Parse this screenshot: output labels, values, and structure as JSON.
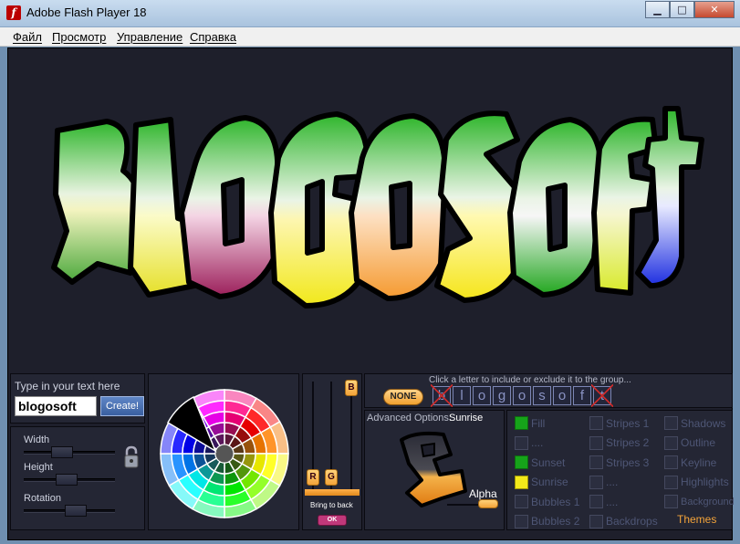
{
  "window": {
    "title": "Adobe Flash Player 18",
    "app_icon_glyph": "f",
    "controls": {
      "minimize": "▁",
      "maximize": "□",
      "close": "✕"
    }
  },
  "menu": [
    "Файл",
    "Просмотр",
    "Управление",
    "Справка"
  ],
  "graffiti": {
    "text": "BLOGOSOFT"
  },
  "text_panel": {
    "label": "Type in your text here",
    "input_value": "blogosoft",
    "create_label": "Create!"
  },
  "size_panel": {
    "width_label": "Width",
    "height_label": "Height",
    "rotation_label": "Rotation",
    "width_level": 0.3,
    "height_level": 0.35,
    "rotation_level": 0.45
  },
  "rgb_panel": {
    "r_label": "R",
    "g_label": "G",
    "b_label": "B",
    "bring_label": "Bring to back",
    "ok_label": "OK"
  },
  "letters_panel": {
    "hint": "Click a letter to include or exclude it to the group...",
    "none_label": "NONE",
    "letters": [
      {
        "char": "b",
        "excluded": true
      },
      {
        "char": "l",
        "excluded": false
      },
      {
        "char": "o",
        "excluded": false
      },
      {
        "char": "g",
        "excluded": false
      },
      {
        "char": "o",
        "excluded": false
      },
      {
        "char": "s",
        "excluded": false
      },
      {
        "char": "o",
        "excluded": false
      },
      {
        "char": "f",
        "excluded": false
      },
      {
        "char": "t",
        "excluded": true
      }
    ]
  },
  "advanced": {
    "label": "Advanced Options:",
    "value": "Sunrise",
    "alpha_label": "Alpha"
  },
  "options": {
    "col1": [
      {
        "label": "Fill",
        "state": "green"
      },
      {
        "label": "....",
        "state": "off"
      },
      {
        "label": "Sunset",
        "state": "green"
      },
      {
        "label": "Sunrise",
        "state": "yellow"
      },
      {
        "label": "Bubbles 1",
        "state": "off"
      },
      {
        "label": "Bubbles 2",
        "state": "off"
      }
    ],
    "col2": [
      {
        "label": "Stripes 1"
      },
      {
        "label": "Stripes 2"
      },
      {
        "label": "Stripes 3"
      },
      {
        "label": "...."
      },
      {
        "label": "...."
      },
      {
        "label": "Backdrops"
      }
    ],
    "col3": [
      {
        "label": "Shadows"
      },
      {
        "label": "Outline"
      },
      {
        "label": "Keyline"
      },
      {
        "label": "Highlights"
      },
      {
        "label": "Background"
      }
    ],
    "themes_label": "Themes"
  },
  "colors": {
    "stage_bg": "#1e1f2b",
    "panel_bg": "#242634",
    "accent_orange": "#f4a43a",
    "graffiti_green": "#2fb52d"
  }
}
